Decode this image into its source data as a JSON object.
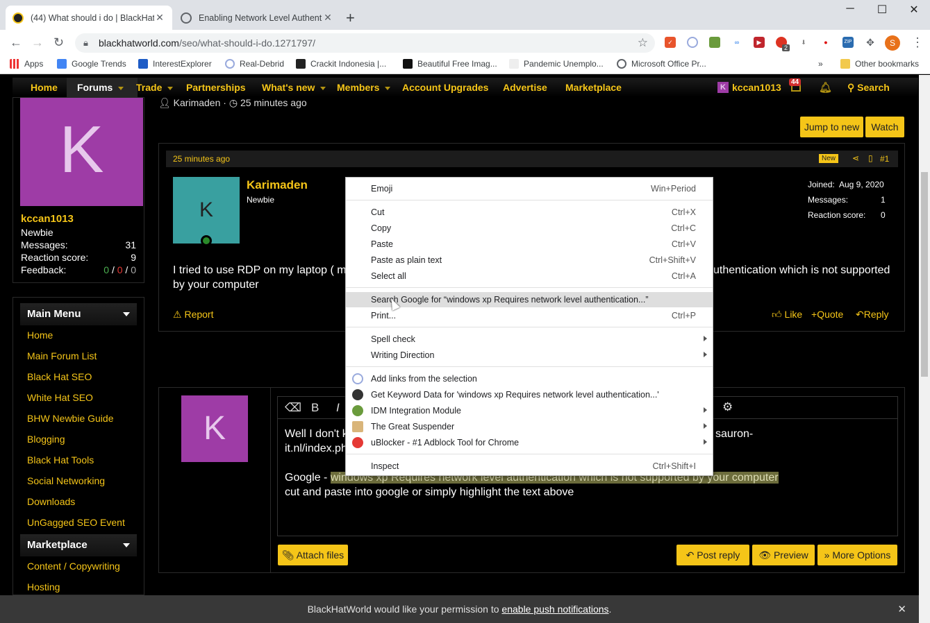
{
  "browser": {
    "tabs": [
      {
        "title": "(44) What should i do | BlackHatW"
      },
      {
        "title": "Enabling Network Level Authenti"
      }
    ],
    "new_tab": "+",
    "window_controls": {
      "minimize": "─",
      "maximize": "☐",
      "close": "✕"
    },
    "url_domain": "blackhatworld.com",
    "url_path": "/seo/what-should-i-do.1271797/",
    "profile_initial": "S",
    "ext_badge": "2",
    "bookmarks": [
      {
        "label": "Apps"
      },
      {
        "label": "Google Trends"
      },
      {
        "label": "InterestExplorer"
      },
      {
        "label": "Real-Debrid"
      },
      {
        "label": "Crackit Indonesia |..."
      },
      {
        "label": "Beautiful Free Imag..."
      },
      {
        "label": "Pandemic Unemplo..."
      },
      {
        "label": "Microsoft Office Pr..."
      }
    ],
    "bookmarks_overflow": "»",
    "other_bookmarks": "Other bookmarks"
  },
  "nav": {
    "items": [
      "Home",
      "Forums",
      "Trade",
      "Partnerships",
      "What's new",
      "Members",
      "Account Upgrades",
      "Advertise",
      "Marketplace"
    ],
    "user": "kccan1013",
    "user_initial": "K",
    "alerts_badge": "44",
    "search": "Search"
  },
  "sidebar": {
    "avatar_letter": "K",
    "username": "kccan1013",
    "role": "Newbie",
    "stats": [
      {
        "label": "Messages:",
        "value": "31"
      },
      {
        "label": "Reaction score:",
        "value": "9"
      }
    ],
    "feedback_label": "Feedback:",
    "feedback_pos": "0",
    "feedback_neg": "0",
    "feedback_neu": "0",
    "feedback_sep": "/",
    "main_menu_title": "Main Menu",
    "main_menu": [
      "Home",
      "Main Forum List",
      "Black Hat SEO",
      "White Hat SEO",
      "BHW Newbie Guide",
      "Blogging",
      "Black Hat Tools",
      "Social Networking",
      "Downloads",
      "UnGagged SEO Event"
    ],
    "marketplace_title": "Marketplace",
    "marketplace": [
      "Content / Copywriting",
      "Hosting"
    ]
  },
  "thread": {
    "starter": "Karimaden",
    "started": "25 minutes ago",
    "jump_to_new": "Jump to new",
    "watch": "Watch"
  },
  "post": {
    "time": "25 minutes ago",
    "new_badge": "New",
    "number": "#1",
    "author": "Karimaden",
    "author_initial": "K",
    "author_role": "Newbie",
    "info": [
      {
        "label": "Joined:",
        "value": "Aug 9, 2020"
      },
      {
        "label": "Messages:",
        "value": "1"
      },
      {
        "label": "Reaction score:",
        "value": "0"
      }
    ],
    "body_left": "I tried to use RDP on my laptop ( my",
    "body_right": "uthentication which is not supported",
    "body_line2": "by your computer",
    "report": "Report",
    "like": "Like",
    "quote": "Quote",
    "reply": "Reply"
  },
  "context_menu": {
    "items": [
      {
        "label": "Emoji",
        "shortcut": "Win+Period"
      },
      {
        "label": "Cut",
        "shortcut": "Ctrl+X"
      },
      {
        "label": "Copy",
        "shortcut": "Ctrl+C"
      },
      {
        "label": "Paste",
        "shortcut": "Ctrl+V"
      },
      {
        "label": "Paste as plain text",
        "shortcut": "Ctrl+Shift+V"
      },
      {
        "label": "Select all",
        "shortcut": "Ctrl+A"
      },
      {
        "label": "Search Google for “windows xp Requires network level authentication...”",
        "shortcut": ""
      },
      {
        "label": "Print...",
        "shortcut": "Ctrl+P"
      },
      {
        "label": "Spell check",
        "shortcut": ""
      },
      {
        "label": "Writing Direction",
        "shortcut": ""
      },
      {
        "label": "Add links from the selection",
        "shortcut": ""
      },
      {
        "label": "Get Keyword Data for 'windows xp Requires network level authentication...'",
        "shortcut": ""
      },
      {
        "label": "IDM Integration Module",
        "shortcut": ""
      },
      {
        "label": "The Great Suspender",
        "shortcut": ""
      },
      {
        "label": "uBlocker - #1 Adblock Tool for Chrome",
        "shortcut": ""
      },
      {
        "label": "Inspect",
        "shortcut": "Ctrl+Shift+I"
      }
    ]
  },
  "reply_box": {
    "avatar_letter": "K",
    "toolbar_bold": "B",
    "toolbar_italic": "I",
    "line1_left": "Well I don't k",
    "line1_right": "sauron-",
    "line2": "it.nl/index.ph",
    "google_prefix": "Google - ",
    "google_highlight": "windows xp Requires network level authentication which is not supported by your computer",
    "line4": "cut and paste into google or simply highlight the text above",
    "attach": "Attach files",
    "post_reply": "Post reply",
    "preview": "Preview",
    "more_options": "More Options"
  },
  "notice": {
    "text_before": "BlackHatWorld would like your permission to ",
    "link": "enable push notifications",
    "text_after": ".",
    "close": "✕"
  },
  "colors": {
    "accent": "#f5c518",
    "avatar_purple": "#9e3ca6",
    "poster_teal": "#39a0a0"
  }
}
